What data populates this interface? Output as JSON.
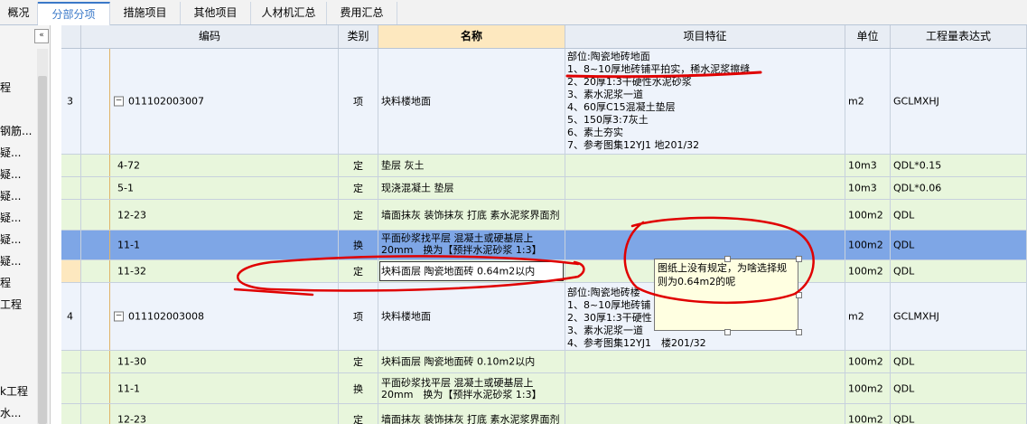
{
  "tabs": [
    {
      "label": "概况",
      "active": false
    },
    {
      "label": "分部分项",
      "active": true
    },
    {
      "label": "措施项目",
      "active": false
    },
    {
      "label": "其他项目",
      "active": false
    },
    {
      "label": "人材机汇总",
      "active": false
    },
    {
      "label": "费用汇总",
      "active": false
    }
  ],
  "sidebar": {
    "collapse_icon": "«",
    "items": [
      "程",
      "钢筋...",
      "疑...",
      "疑...",
      "疑...",
      "疑...",
      "疑...",
      "疑...",
      "程",
      "工程",
      "k工程",
      "水..."
    ]
  },
  "columns": [
    "编码",
    "类别",
    "名称",
    "项目特征",
    "单位",
    "工程量表达式"
  ],
  "rows": [
    {
      "num": "3",
      "code": "011102003007",
      "type": "项",
      "name": "块料楼地面",
      "features": [
        "部位:陶瓷地砖地面",
        "1、8~10厚地砖铺平拍实，稀水泥浆擦缝",
        "2、20厚1:3干硬性水泥砂浆",
        "3、素水泥浆一道",
        "4、60厚C15混凝土垫层",
        "5、150厚3:7灰土",
        "6、素土夯实",
        "7、参考图集12YJ1 地201/32"
      ],
      "unit": "m2",
      "expr": "GCLMXHJ"
    },
    {
      "num": "",
      "code": "4-72",
      "type": "定",
      "name": "垫层 灰土",
      "unit": "10m3",
      "expr": "QDL*0.15"
    },
    {
      "num": "",
      "code": "5-1",
      "type": "定",
      "name": "现浇混凝土 垫层",
      "unit": "10m3",
      "expr": "QDL*0.06"
    },
    {
      "num": "",
      "code": "12-23",
      "type": "定",
      "name": "墙面抹灰 装饰抹灰 打底 素水泥浆界面剂",
      "unit": "100m2",
      "expr": "QDL"
    },
    {
      "num": "",
      "code": "11-1",
      "type": "换",
      "name": "平面砂浆找平层 混凝土或硬基层上20mm　换为【预拌水泥砂浆 1:3】",
      "unit": "100m2",
      "expr": "QDL"
    },
    {
      "num": "",
      "code": "11-32",
      "type": "定",
      "name": "块料面层 陶瓷地面砖 0.64m2以内",
      "unit": "100m2",
      "expr": "QDL"
    },
    {
      "num": "4",
      "code": "011102003008",
      "type": "项",
      "name": "块料楼地面",
      "features": [
        "部位:陶瓷地砖楼",
        "1、8~10厚地砖铺",
        "2、30厚1:3干硬性",
        "3、素水泥浆一道",
        "4、参考图集12YJ1　楼201/32"
      ],
      "unit": "m2",
      "expr": "GCLMXHJ"
    },
    {
      "num": "",
      "code": "11-30",
      "type": "定",
      "name": "块料面层 陶瓷地面砖 0.10m2以内",
      "unit": "100m2",
      "expr": "QDL"
    },
    {
      "num": "",
      "code": "11-1",
      "type": "换",
      "name": "平面砂浆找平层 混凝土或硬基层上20mm　换为【预拌水泥砂浆 1:3】",
      "unit": "100m2",
      "expr": "QDL"
    },
    {
      "num": "",
      "code": "12-23",
      "type": "定",
      "name": "墙面抹灰 装饰抹灰 打底 素水泥浆界面剂",
      "unit": "100m2",
      "expr": "QDL"
    }
  ],
  "annotation": {
    "text": "图纸上没有规定，为啥选择规则为0.64m2的呢"
  },
  "colors": {
    "accent": "#3a78c8",
    "selected_row": "#7ea6e6",
    "sub_row": "#e8f6dc",
    "main_row": "#eef3fb",
    "annotation_ink": "#e00000"
  }
}
